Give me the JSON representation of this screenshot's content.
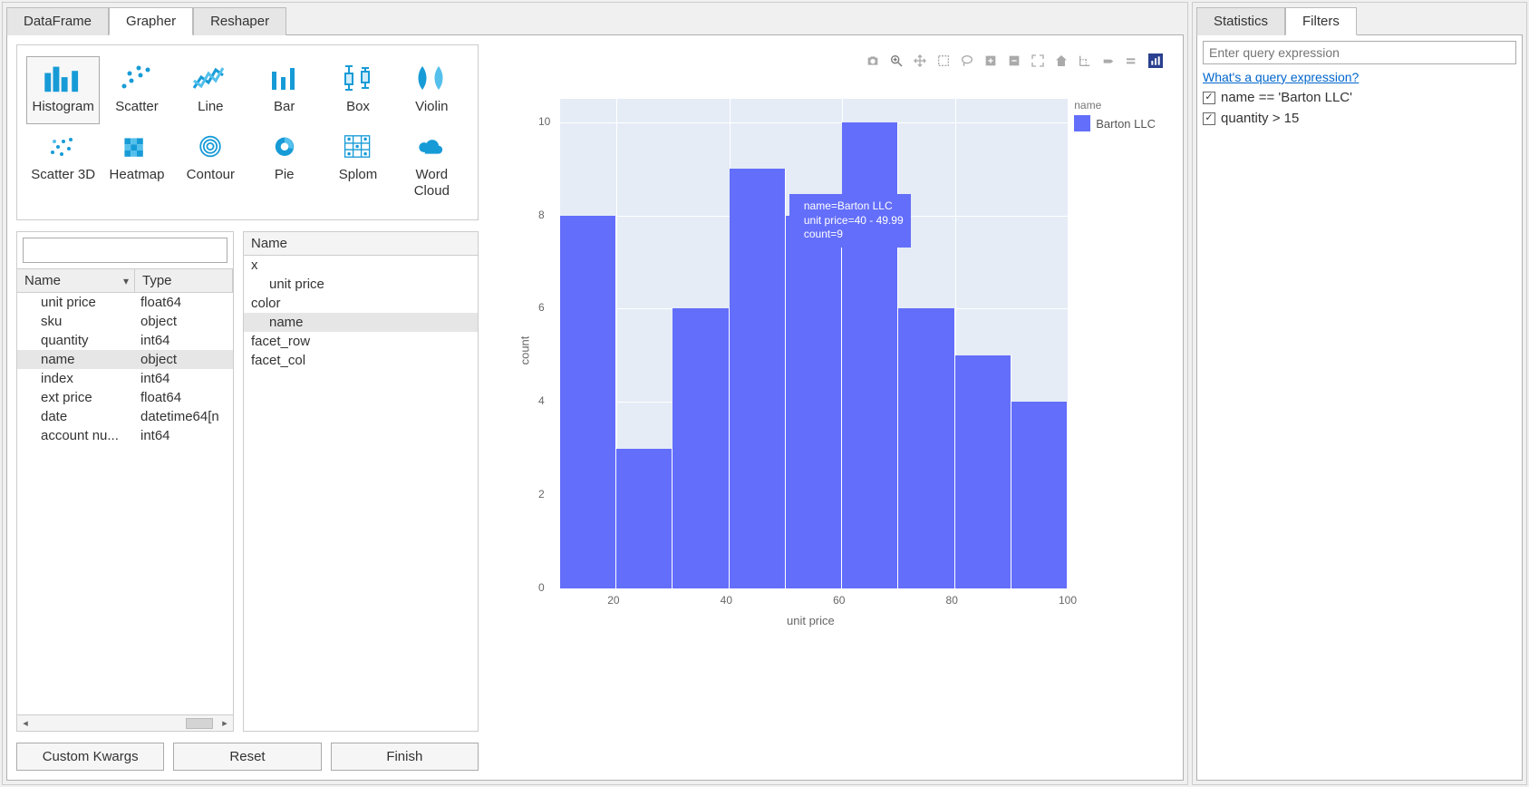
{
  "main_tabs": {
    "items": [
      "DataFrame",
      "Grapher",
      "Reshaper"
    ],
    "active": 1
  },
  "chart_types": {
    "items": [
      {
        "label": "Histogram",
        "name": "histogram",
        "selected": true
      },
      {
        "label": "Scatter",
        "name": "scatter"
      },
      {
        "label": "Line",
        "name": "line"
      },
      {
        "label": "Bar",
        "name": "bar"
      },
      {
        "label": "Box",
        "name": "box"
      },
      {
        "label": "Violin",
        "name": "violin"
      },
      {
        "label": "Scatter 3D",
        "name": "scatter3d"
      },
      {
        "label": "Heatmap",
        "name": "heatmap"
      },
      {
        "label": "Contour",
        "name": "contour"
      },
      {
        "label": "Pie",
        "name": "pie"
      },
      {
        "label": "Splom",
        "name": "splom"
      },
      {
        "label": "Word Cloud",
        "name": "wordcloud"
      }
    ]
  },
  "field_table": {
    "headers": {
      "name": "Name",
      "type": "Type"
    },
    "rows": [
      {
        "name": "unit price",
        "type": "float64"
      },
      {
        "name": "sku",
        "type": "object"
      },
      {
        "name": "quantity",
        "type": "int64"
      },
      {
        "name": "name",
        "type": "object",
        "selected": true
      },
      {
        "name": "index",
        "type": "int64"
      },
      {
        "name": "ext price",
        "type": "float64"
      },
      {
        "name": "date",
        "type": "datetime64[n"
      },
      {
        "name": "account nu...",
        "type": "int64"
      }
    ]
  },
  "mapping": {
    "title": "Name",
    "items": [
      {
        "label": "x",
        "child": false
      },
      {
        "label": "unit price",
        "child": true
      },
      {
        "label": "color",
        "child": false
      },
      {
        "label": "name",
        "child": true,
        "selected": true
      },
      {
        "label": "facet_row",
        "child": false
      },
      {
        "label": "facet_col",
        "child": false
      }
    ]
  },
  "buttons": {
    "custom_kwargs": "Custom Kwargs",
    "reset": "Reset",
    "finish": "Finish"
  },
  "legend": {
    "title": "name",
    "item": "Barton LLC"
  },
  "xlabel": "unit price",
  "ylabel": "count",
  "tooltip": {
    "l1": "name=Barton LLC",
    "l2": "unit price=40 - 49.99",
    "l3": "count=9"
  },
  "xticks": [
    "20",
    "40",
    "60",
    "80",
    "100"
  ],
  "yticks": [
    "0",
    "2",
    "4",
    "6",
    "8",
    "10"
  ],
  "chart_data": {
    "type": "histogram",
    "xlabel": "unit price",
    "ylabel": "count",
    "xlim": [
      10,
      100
    ],
    "ylim": [
      0,
      10.5
    ],
    "bin_width": 10,
    "series": [
      {
        "name": "Barton LLC",
        "color": "#636efa",
        "bins": [
          {
            "range": [
              10,
              19.99
            ],
            "count": 8
          },
          {
            "range": [
              20,
              29.99
            ],
            "count": 3
          },
          {
            "range": [
              30,
              39.99
            ],
            "count": 6
          },
          {
            "range": [
              40,
              49.99
            ],
            "count": 9
          },
          {
            "range": [
              50,
              59.99
            ],
            "count": 8
          },
          {
            "range": [
              60,
              69.99
            ],
            "count": 10
          },
          {
            "range": [
              70,
              79.99
            ],
            "count": 6
          },
          {
            "range": [
              80,
              89.99
            ],
            "count": 5
          },
          {
            "range": [
              90,
              99.99
            ],
            "count": 4
          }
        ]
      }
    ],
    "hovered": {
      "series": "Barton LLC",
      "bin": [
        40,
        49.99
      ],
      "count": 9
    }
  },
  "side_tabs": {
    "items": [
      "Statistics",
      "Filters"
    ],
    "active": 1
  },
  "filters": {
    "placeholder": "Enter query expression",
    "help_link": "What's a query expression?",
    "active": [
      "name == 'Barton LLC'",
      "quantity > 15"
    ]
  }
}
